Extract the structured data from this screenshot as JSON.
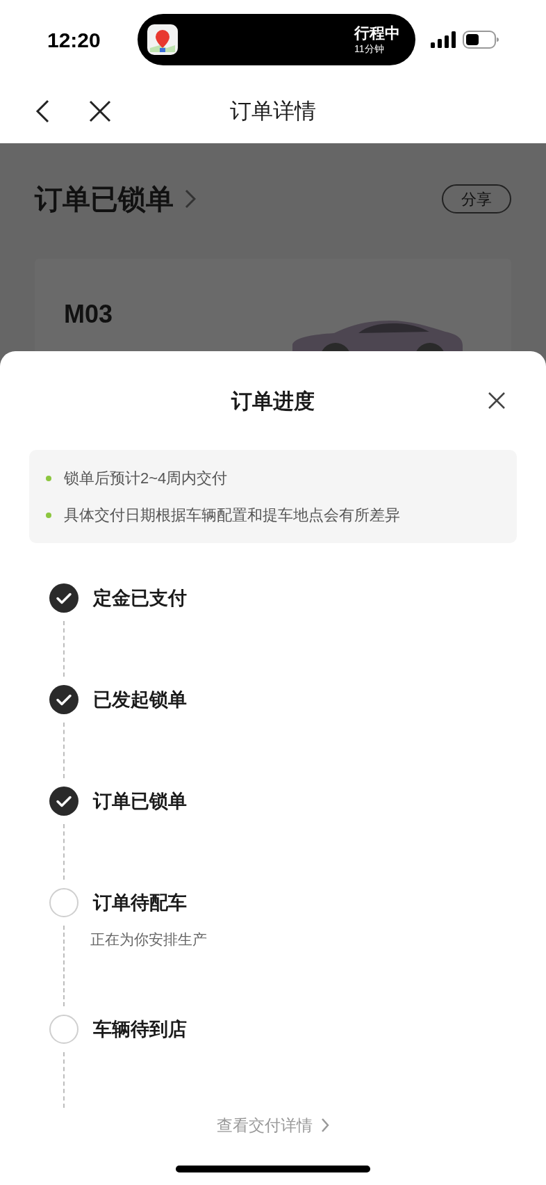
{
  "status_bar": {
    "time": "12:20",
    "activity_title": "行程中",
    "activity_subtitle": "11分钟"
  },
  "nav_bar": {
    "title": "订单详情"
  },
  "background_page": {
    "status_title": "订单已锁单",
    "share_button": "分享",
    "car_model": "M03"
  },
  "sheet": {
    "title": "订单进度",
    "notes": [
      "锁单后预计2~4周内交付",
      "具体交付日期根据车辆配置和提车地点会有所差异"
    ],
    "steps": [
      {
        "label": "定金已支付",
        "completed": true
      },
      {
        "label": "已发起锁单",
        "completed": true
      },
      {
        "label": "订单已锁单",
        "completed": true
      },
      {
        "label": "订单待配车",
        "completed": false,
        "subtitle": "正在为你安排生产"
      },
      {
        "label": "车辆待到店",
        "completed": false
      }
    ],
    "details_link": "查看交付详情"
  }
}
